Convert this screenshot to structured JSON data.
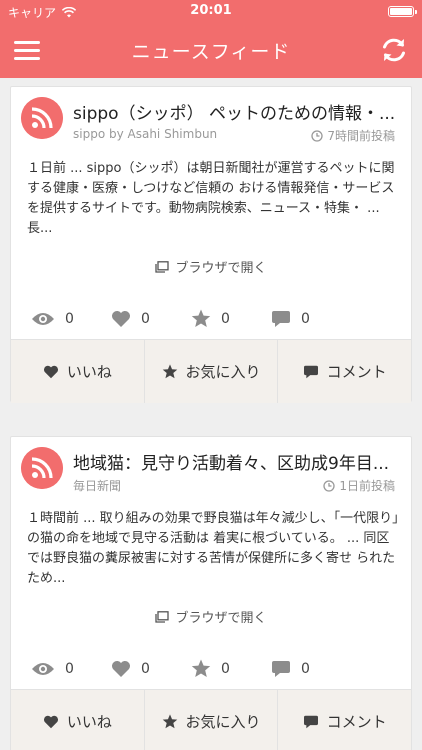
{
  "status_bar": {
    "carrier": "キャリア",
    "time": "20:01"
  },
  "navbar": {
    "title": "ニュースフィード"
  },
  "feed": [
    {
      "title": "sippo（シッポ） ペットのための情報・...",
      "source": "sippo by Asahi Shimbun",
      "posted": "7時間前投稿",
      "body": "１日前 ... sippo（シッポ）は朝日新聞社が運営するペットに関する健康・医療・しつけなど信頼の おける情報発信・サービスを提供するサイトです。動物病院検索、ニュース・特集・ ... 長...",
      "open_label": "ブラウザで開く",
      "stats": {
        "views": "0",
        "likes": "0",
        "favorites": "0",
        "comments": "0"
      },
      "actions": {
        "like": "いいね",
        "favorite": "お気に入り",
        "comment": "コメント"
      }
    },
    {
      "title": "地域猫：見守り活動着々、区助成9年目...",
      "source": "毎日新聞",
      "posted": "1日前投稿",
      "body": "１時間前 ... 取り組みの効果で野良猫は年々減少し、「一代限り」の猫の命を地域で見守る活動は 着実に根づいている。 ... 同区では野良猫の糞尿被害に対する苦情が保健所に多く寄せ られたため...",
      "open_label": "ブラウザで開く",
      "stats": {
        "views": "0",
        "likes": "0",
        "favorites": "0",
        "comments": "0"
      },
      "actions": {
        "like": "いいね",
        "favorite": "お気に入り",
        "comment": "コメント"
      }
    }
  ]
}
